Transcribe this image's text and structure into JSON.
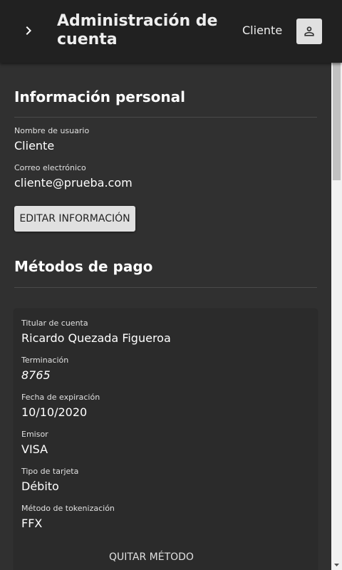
{
  "header": {
    "title": "Administración de cuenta",
    "user_name": "Cliente",
    "menu_icon": "chevron-right-icon",
    "account_icon": "person-icon"
  },
  "personal": {
    "section_title": "Información personal",
    "username_label": "Nombre de usuario",
    "username_value": "Cliente",
    "email_label": "Correo electrónico",
    "email_value": "cliente@prueba.com",
    "edit_button": "EDITAR INFORMACIÓN"
  },
  "payment": {
    "section_title": "Métodos de pago",
    "card": {
      "holder_label": "Titular de cuenta",
      "holder_value": "Ricardo Quezada Figueroa",
      "ending_label": "Terminación",
      "ending_value": "8765",
      "expiry_label": "Fecha de expiración",
      "expiry_value": "10/10/2020",
      "issuer_label": "Emisor",
      "issuer_value": "VISA",
      "type_label": "Tipo de tarjeta",
      "type_value": "Débito",
      "token_label": "Método de tokenización",
      "token_value": "FFX",
      "remove_button": "QUITAR MÉTODO"
    }
  },
  "colors": {
    "background": "#303030",
    "app_bar": "#212121",
    "button": "#e0e0e0"
  }
}
